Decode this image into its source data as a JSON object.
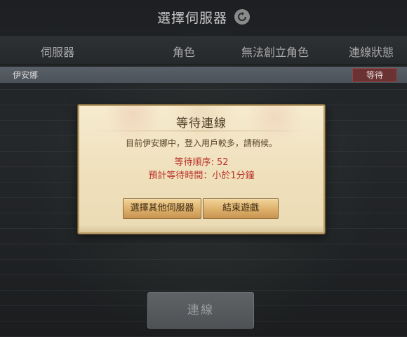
{
  "title": "選擇伺服器",
  "header": {
    "server": "伺服器",
    "character": "角色",
    "cannot_create": "無法創立角色",
    "connection_status": "連線狀態"
  },
  "servers": [
    {
      "name": "伊安娜",
      "status": "等待"
    }
  ],
  "dialog": {
    "title": "等待連線",
    "message": "目前伊安娜中，登入用戶較多，請稍候。",
    "queue_line": "等待順序: 52",
    "wait_line": "預計等待時間：小於1分鐘",
    "btn_other_server": "選擇其他伺服器",
    "btn_exit": "結束遊戲"
  },
  "connect_button": "連線",
  "icons": {
    "refresh": "refresh-icon"
  },
  "colors": {
    "status_badge_bg": "#6a3232",
    "warning_text": "#b8322a",
    "dialog_bg": "#f6ebd0"
  }
}
